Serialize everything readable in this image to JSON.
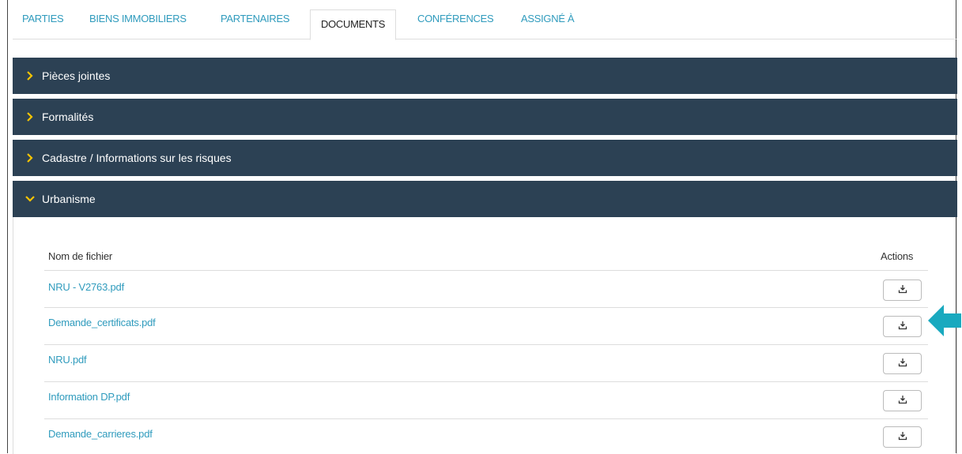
{
  "tabs": [
    {
      "label": "PARTIES",
      "active": false
    },
    {
      "label": "BIENS IMMOBILIERS",
      "active": false
    },
    {
      "label": "PARTENAIRES",
      "active": false
    },
    {
      "label": "DOCUMENTS",
      "active": true
    },
    {
      "label": "CONFÉRENCES",
      "active": false
    },
    {
      "label": "ASSIGNÉ À",
      "active": false
    }
  ],
  "panels": [
    {
      "label": "Pièces jointes",
      "expanded": false
    },
    {
      "label": "Formalités",
      "expanded": false
    },
    {
      "label": "Cadastre / Informations sur les risques",
      "expanded": false
    },
    {
      "label": "Urbanisme",
      "expanded": true
    }
  ],
  "table": {
    "col_filename": "Nom de fichier",
    "col_actions": "Actions",
    "rows": [
      {
        "filename": "NRU - V2763.pdf",
        "action_icon": "download-icon"
      },
      {
        "filename": "Demande_certificats.pdf",
        "action_icon": "download-icon"
      },
      {
        "filename": "NRU.pdf",
        "action_icon": "download-icon"
      },
      {
        "filename": "Information DP.pdf",
        "action_icon": "download-icon"
      },
      {
        "filename": "Demande_carrieres.pdf",
        "action_icon": "download-icon"
      }
    ]
  },
  "colors": {
    "accent": "#2f9bbd",
    "panel_header": "#2c4154",
    "chevron": "#f5c400",
    "callout_arrow": "#19a9bf"
  }
}
